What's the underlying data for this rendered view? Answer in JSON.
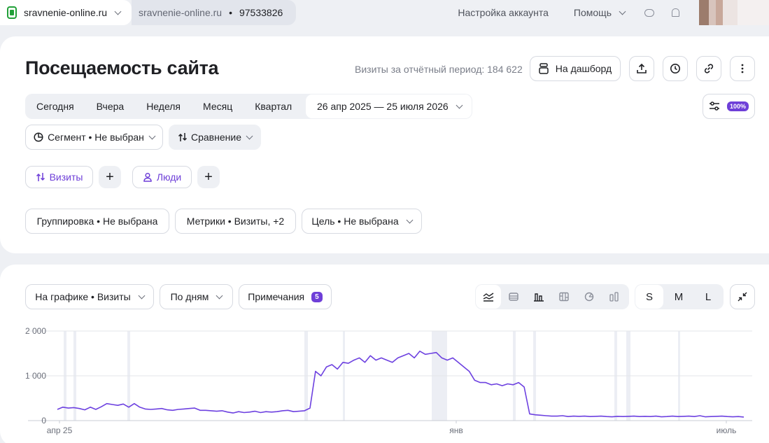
{
  "topbar": {
    "site": "sravnenie-online.ru",
    "counter_site": "sravnenie-online.ru",
    "counter_sep": "•",
    "counter_id": "97533826",
    "account_settings": "Настройка аккаунта",
    "help": "Помощь"
  },
  "header": {
    "title": "Посещаемость сайта",
    "visits_total": "Визиты за отчётный период: 184 622",
    "dashboard_button": "На дашборд"
  },
  "period": {
    "items": [
      "Сегодня",
      "Вчера",
      "Неделя",
      "Месяц",
      "Квартал"
    ],
    "range": "26 апр 2025 — 25 июля 2026",
    "sampling": "100%"
  },
  "filters": {
    "segment": "Сегмент • Не выбран",
    "compare": "Сравнение"
  },
  "chips": {
    "visits": "Визиты",
    "people": "Люди",
    "plus": "+"
  },
  "report": {
    "grouping": "Группировка • Не выбрана",
    "metrics": "Метрики • Визиты, +2",
    "goal": "Цель • Не выбрана"
  },
  "chart_toolbar": {
    "on_chart": "На графике • Визиты",
    "by_days": "По дням",
    "notes": "Примечания",
    "notes_count": "5",
    "sizes": [
      "S",
      "M",
      "L"
    ],
    "active_size": "S"
  },
  "colors": {
    "accent": "#6e3fd8",
    "line": "#6d41e0"
  },
  "chart_data": {
    "type": "line",
    "x_start": "2025-04-26",
    "x_end": "2026-07-25",
    "y_ticks": [
      "0",
      "1 000",
      "2 000"
    ],
    "x_ticks": [
      "апр 25",
      "янв",
      "июль"
    ],
    "ylim": [
      0,
      2000
    ],
    "grid": true,
    "series": [
      {
        "values": [
          250,
          300,
          280,
          290,
          270,
          240,
          300,
          250,
          310,
          380,
          360,
          340,
          370,
          300,
          380,
          300,
          260,
          250,
          260,
          270,
          240,
          230,
          250,
          260,
          270,
          280,
          230,
          230,
          220,
          210,
          220,
          190,
          170,
          200,
          180,
          190,
          210,
          180,
          200,
          190,
          200,
          220,
          230,
          200,
          210,
          220,
          280,
          1100,
          1000,
          1200,
          1250,
          1150,
          1300,
          1280,
          1350,
          1400,
          1300,
          1450,
          1350,
          1400,
          1350,
          1300,
          1400,
          1450,
          1500,
          1400,
          1550,
          1480,
          1500,
          1520,
          1400,
          1350,
          1400,
          1300,
          1200,
          1100,
          900,
          850,
          850,
          800,
          820,
          780,
          820,
          800,
          850,
          750,
          150,
          130,
          120,
          110,
          100,
          100,
          110,
          90,
          100,
          95,
          100,
          90,
          95,
          100,
          90,
          85,
          95,
          90,
          95,
          100,
          90,
          95,
          90,
          100,
          85,
          90,
          100,
          90,
          95,
          100,
          90,
          110,
          85,
          90,
          95,
          100,
          90,
          85,
          90,
          80
        ]
      }
    ]
  }
}
